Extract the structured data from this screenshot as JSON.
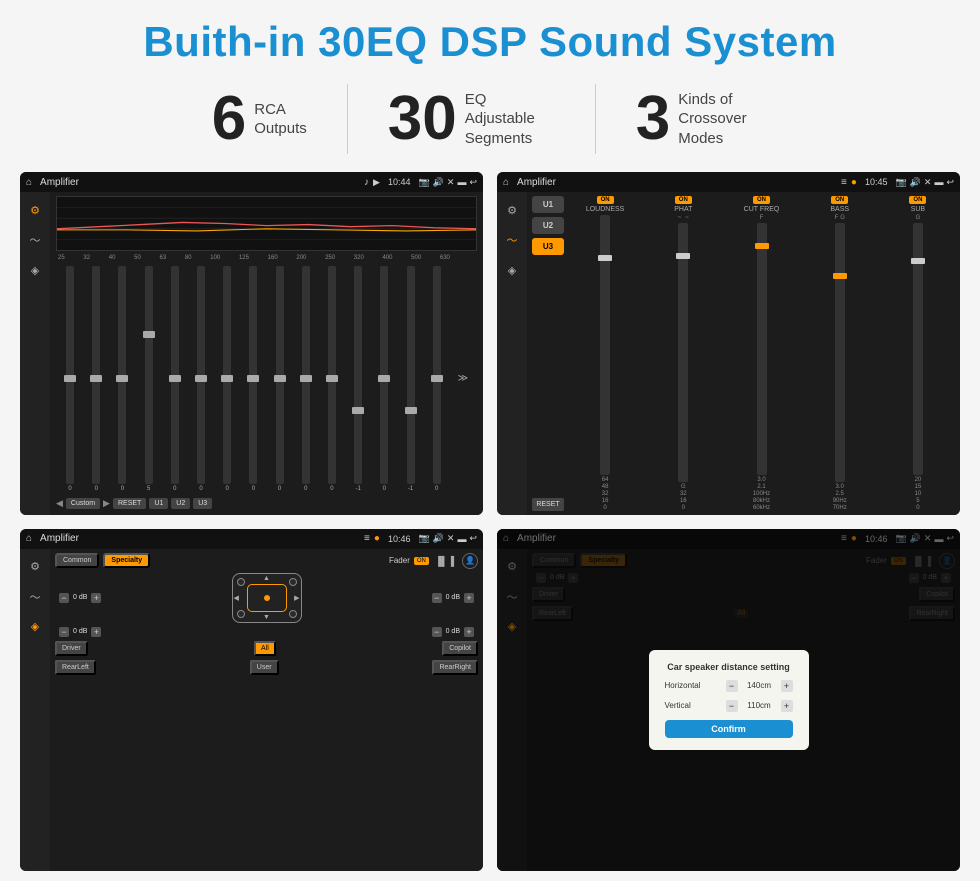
{
  "header": {
    "title": "Buith-in 30EQ DSP Sound System"
  },
  "stats": [
    {
      "number": "6",
      "label": "RCA\nOutputs"
    },
    {
      "number": "30",
      "label": "EQ Adjustable\nSegments"
    },
    {
      "number": "3",
      "label": "Kinds of\nCrossover Modes"
    }
  ],
  "screens": [
    {
      "id": "eq-screen",
      "statusBar": {
        "title": "Amplifier",
        "time": "10:44"
      },
      "type": "eq",
      "eq": {
        "bands": [
          "25",
          "32",
          "40",
          "50",
          "63",
          "80",
          "100",
          "125",
          "160",
          "200",
          "250",
          "320",
          "400",
          "500",
          "630"
        ],
        "values": [
          "0",
          "0",
          "0",
          "5",
          "0",
          "0",
          "0",
          "0",
          "0",
          "0",
          "0",
          "-1",
          "0",
          "-1",
          "0"
        ],
        "thumbPositions": [
          50,
          50,
          50,
          30,
          50,
          50,
          50,
          50,
          50,
          50,
          50,
          65,
          50,
          65,
          50
        ],
        "presetLabel": "Custom",
        "buttons": [
          "RESET",
          "U1",
          "U2",
          "U3"
        ]
      }
    },
    {
      "id": "crossover-screen",
      "statusBar": {
        "title": "Amplifier",
        "time": "10:45"
      },
      "type": "crossover",
      "crossover": {
        "modes": [
          "U1",
          "U2",
          "U3"
        ],
        "cols": [
          {
            "name": "LOUDNESS",
            "on": true
          },
          {
            "name": "PHAT",
            "on": true
          },
          {
            "name": "CUT FREQ",
            "on": true
          },
          {
            "name": "BASS",
            "on": true
          },
          {
            "name": "SUB",
            "on": true
          }
        ]
      }
    },
    {
      "id": "fader-screen",
      "statusBar": {
        "title": "Amplifier",
        "time": "10:46"
      },
      "type": "fader",
      "fader": {
        "tabs": [
          "Common",
          "Specialty"
        ],
        "activeTab": "Specialty",
        "faderLabel": "Fader",
        "faderOn": true,
        "channels": [
          "Driver",
          "Copilot",
          "RearLeft",
          "RearRight",
          "All",
          "User"
        ],
        "dbValues": [
          "0 dB",
          "0 dB",
          "0 dB",
          "0 dB"
        ]
      }
    },
    {
      "id": "dialog-screen",
      "statusBar": {
        "title": "Amplifier",
        "time": "10:46"
      },
      "type": "dialog",
      "dialog": {
        "title": "Car speaker distance setting",
        "horizontal": {
          "label": "Horizontal",
          "value": "140cm"
        },
        "vertical": {
          "label": "Vertical",
          "value": "110cm"
        },
        "confirmLabel": "Confirm"
      },
      "fader": {
        "tabs": [
          "Common",
          "Specialty"
        ],
        "activeTab": "Specialty",
        "faderLabel": "Fader",
        "faderOn": true,
        "dbValues": [
          "0 dB",
          "0 dB",
          "0 dB",
          "0 dB"
        ]
      }
    }
  ]
}
